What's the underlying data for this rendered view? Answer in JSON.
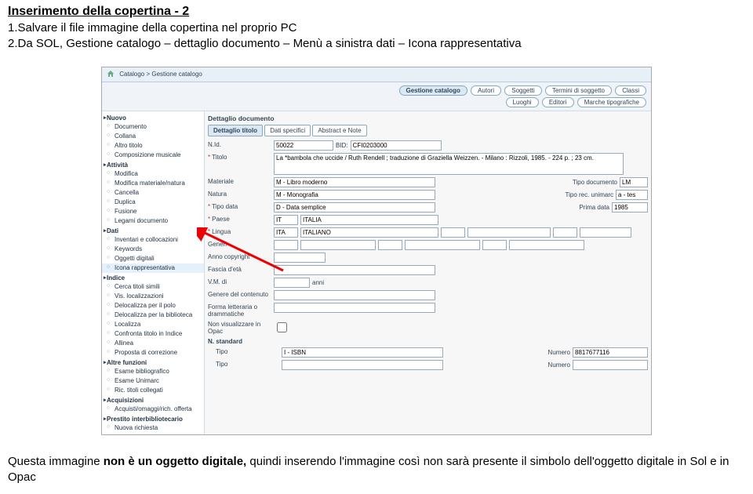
{
  "heading": "Inserimento della copertina - 2",
  "instruction_lines": [
    "1.Salvare il file immagine della copertina nel proprio PC",
    "2.Da SOL, Gestione catalogo – dettaglio documento – Menù a sinistra dati – Icona rappresentativa"
  ],
  "breadcrumb": "Catalogo > Gestione catalogo",
  "topbuttons_row1": [
    "Gestione catalogo",
    "Autori",
    "Soggetti",
    "Termini di soggetto",
    "Classi"
  ],
  "topbuttons_row2": [
    "Luoghi",
    "Editori",
    "Marche tipografiche"
  ],
  "content_title": "Dettaglio documento",
  "tabs": [
    "Dettaglio titolo",
    "Dati specifici",
    "Abstract e Note"
  ],
  "sidebar": {
    "nuovo": "Nuovo",
    "nuovo_items": [
      "Documento",
      "Collana",
      "Altro titolo",
      "Composizione musicale"
    ],
    "attivita": "Attività",
    "attivita_items": [
      "Modifica",
      "Modifica materiale/natura",
      "Cancella",
      "Duplica",
      "Fusione",
      "Legami documento"
    ],
    "dati": "Dati",
    "dati_items": [
      "Inventari e collocazioni",
      "Keywords",
      "Oggetti digitali",
      "Icona rappresentativa"
    ],
    "indice": "Indice",
    "indice_items": [
      "Cerca titoli simili",
      "Vis. localizzazioni",
      "Delocalizza per il polo",
      "Delocalizza per la biblioteca",
      "Localizza",
      "Confronta titolo in Indice",
      "Allinea",
      "Proposta di correzione"
    ],
    "altre": "Altre funzioni",
    "altre_items": [
      "Esame bibliografico",
      "Esame Unimarc",
      "Ric. titoli collegati"
    ],
    "acq": "Acquisizioni",
    "acq_items": [
      "Acquisti/omaggi/rich. offerta"
    ],
    "prestito": "Prestito interbibliotecario",
    "prestito_items": [
      "Nuova richiesta"
    ]
  },
  "form": {
    "nid_label": "N.Id.",
    "nid_value": "50022",
    "bid_label": "BID:",
    "bid_value": "CFI0203000",
    "titolo_label": "Titolo",
    "titolo_value": "La *bambola che uccide / Ruth Rendell ; traduzione di Graziella Weizzen. - Milano : Rizzoli, 1985. - 224 p. ; 23 cm.",
    "materiale_label": "Materiale",
    "materiale_value": "M - Libro moderno",
    "tipodoc_label": "Tipo documento",
    "tipodoc_value": "LM",
    "natura_label": "Natura",
    "natura_value": "M - Monografia",
    "tiporec_label": "Tipo rec. unimarc",
    "tiporec_value": "a - tes",
    "tipodata_label": "Tipo data",
    "tipodata_value": "D - Data semplice",
    "primadata_label": "Prima data",
    "primadata_value": "1985",
    "paese_label": "Paese",
    "paese_code": "IT",
    "paese_name": "ITALIA",
    "lingua_label": "Lingua",
    "lingua_code": "ITA",
    "lingua_name": "ITALIANO",
    "generi_label": "Generi",
    "anno_copy_label": "Anno copyright",
    "fascia_label": "Fascia d'età",
    "vm_label": "V.M. di",
    "anni_label": "anni",
    "genere_cont_label": "Genere del contenuto",
    "forma_label": "Forma letteraria o drammatiche",
    "nonvis_label": "Non visualizzare in Opac",
    "nstd_label": "N. standard",
    "tipo_label": "Tipo",
    "tipo_value": "I - ISBN",
    "numero_label": "Numero",
    "numero_value": "8817677116"
  },
  "footer_strong": "non è un oggetto digitale,",
  "footer_rest": " quindi inserendo l'immagine così non sarà presente il simbolo dell'oggetto digitale in Sol e in Opac",
  "footer_pre": "Questa immagine "
}
